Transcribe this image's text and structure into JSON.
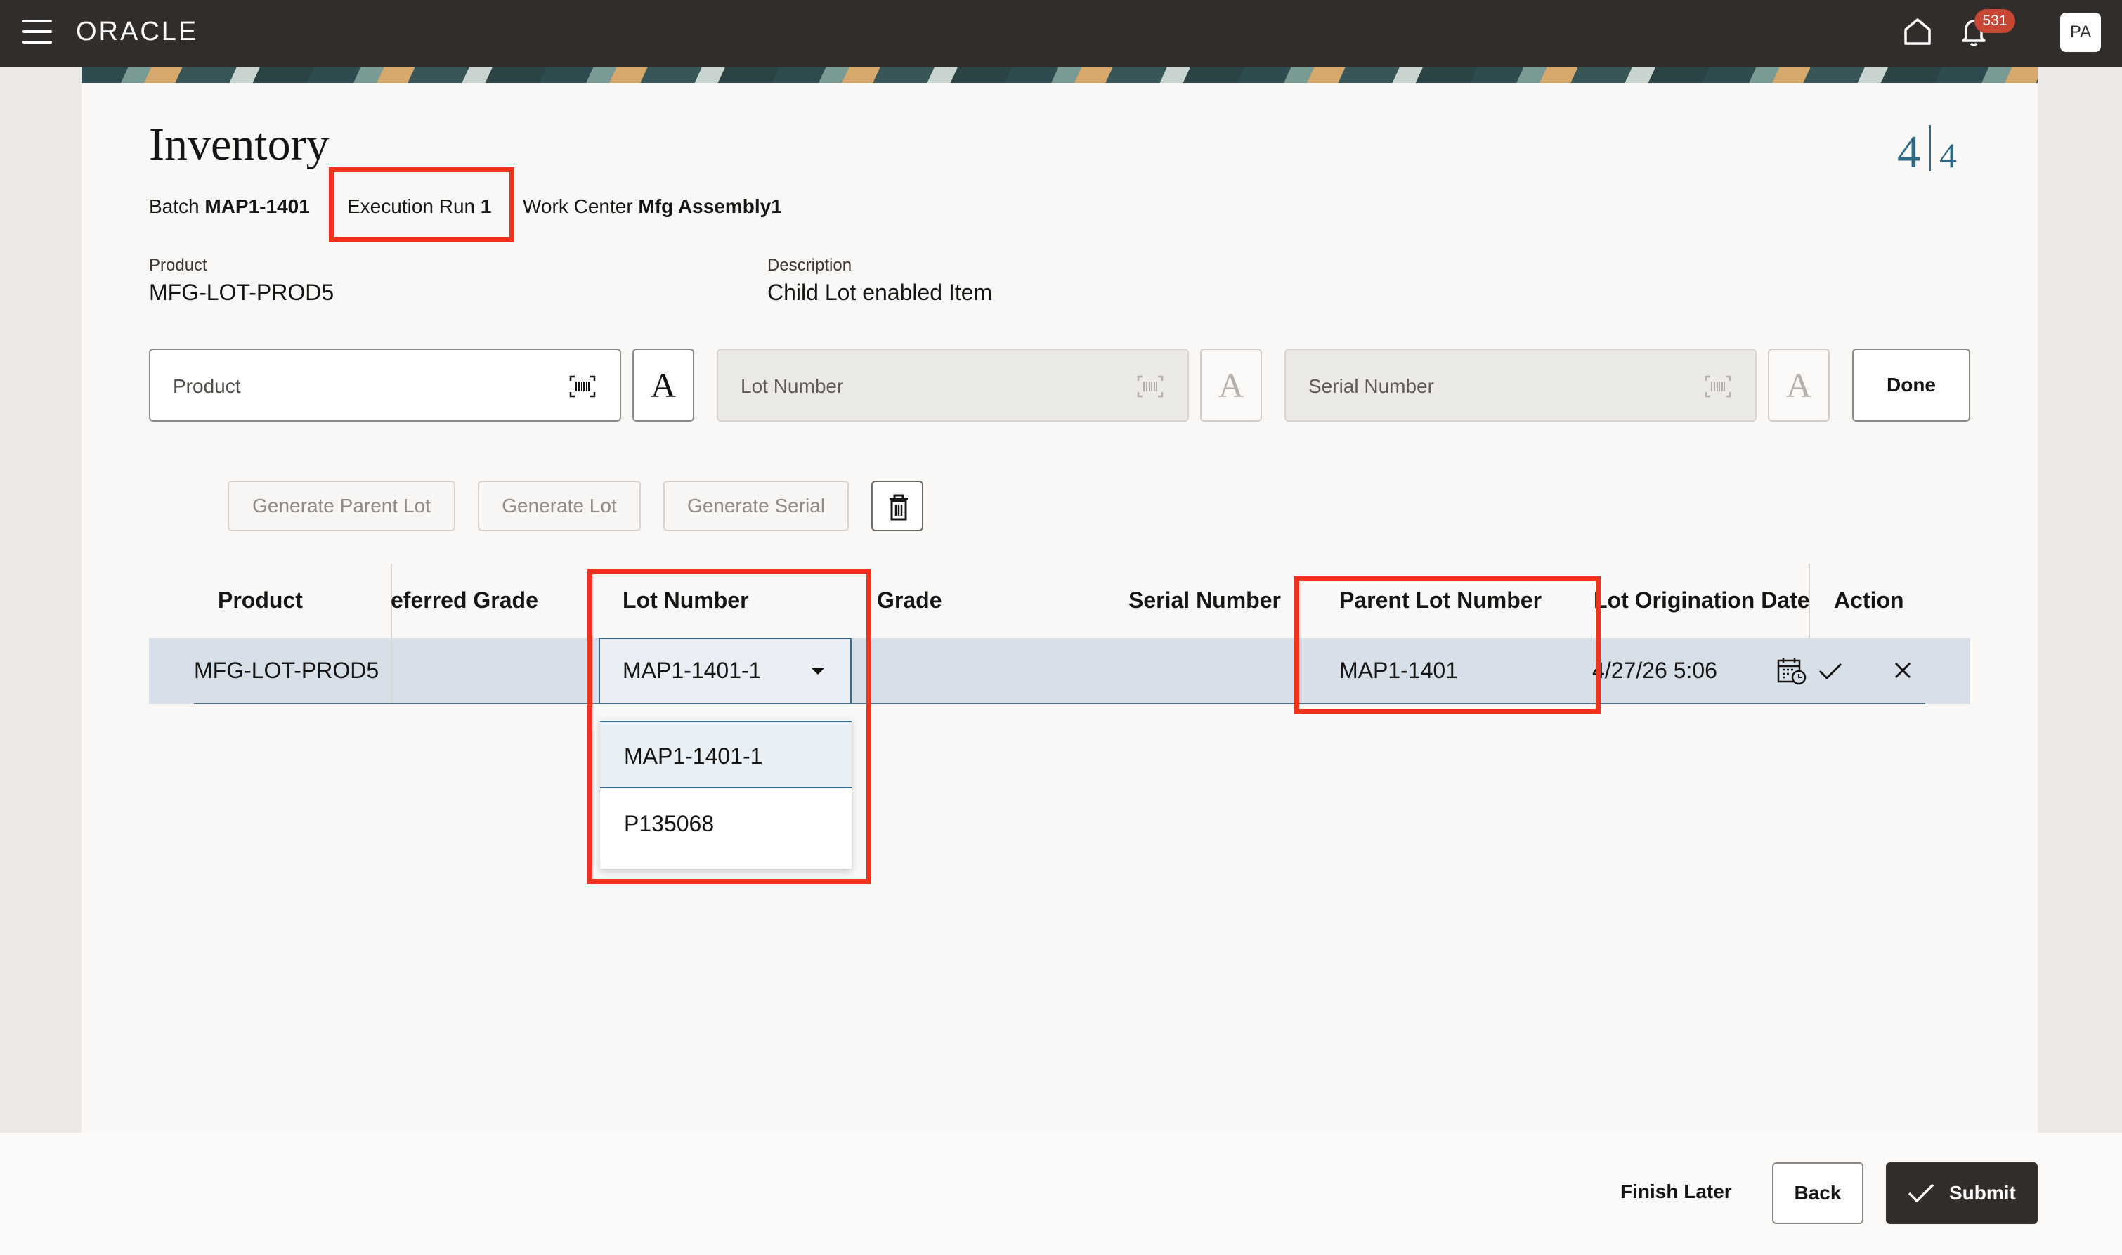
{
  "topbar": {
    "brand": "ORACLE",
    "notification_count": "531",
    "avatar_initials": "PA"
  },
  "page": {
    "title": "Inventory",
    "step_current": "4",
    "step_total": "4",
    "batch_label": "Batch",
    "batch_value": "MAP1-1401",
    "execution_label": "Execution Run",
    "execution_value": "1",
    "workcenter_label": "Work Center",
    "workcenter_value": "Mfg Assembly1",
    "product_label": "Product",
    "product_value": "MFG-LOT-PROD5",
    "description_label": "Description",
    "description_value": "Child Lot enabled Item"
  },
  "scan": {
    "product_placeholder": "Product",
    "lot_placeholder": "Lot Number",
    "serial_placeholder": "Serial Number",
    "keyboard_glyph": "A",
    "done_label": "Done"
  },
  "actions": {
    "generate_parent_lot": "Generate Parent Lot",
    "generate_lot": "Generate Lot",
    "generate_serial": "Generate Serial"
  },
  "table": {
    "headers": [
      "Product",
      "eferred Grade",
      "Lot Number",
      "Grade",
      "Serial Number",
      "Parent Lot Number",
      "Lot Origination Date",
      "Action"
    ],
    "row": {
      "product": "MFG-LOT-PROD5",
      "lot_number": "MAP1-1401-1",
      "parent_lot_number": "MAP1-1401",
      "origination_date": "4/27/26 5:06"
    },
    "lot_options": [
      "MAP1-1401-1",
      "P135068"
    ]
  },
  "footer": {
    "finish_later": "Finish Later",
    "back": "Back",
    "submit": "Submit"
  },
  "colors": {
    "accent_red": "#f3321e",
    "topbar": "#312d2a",
    "badge": "#c74634",
    "step": "#2e6a84"
  }
}
